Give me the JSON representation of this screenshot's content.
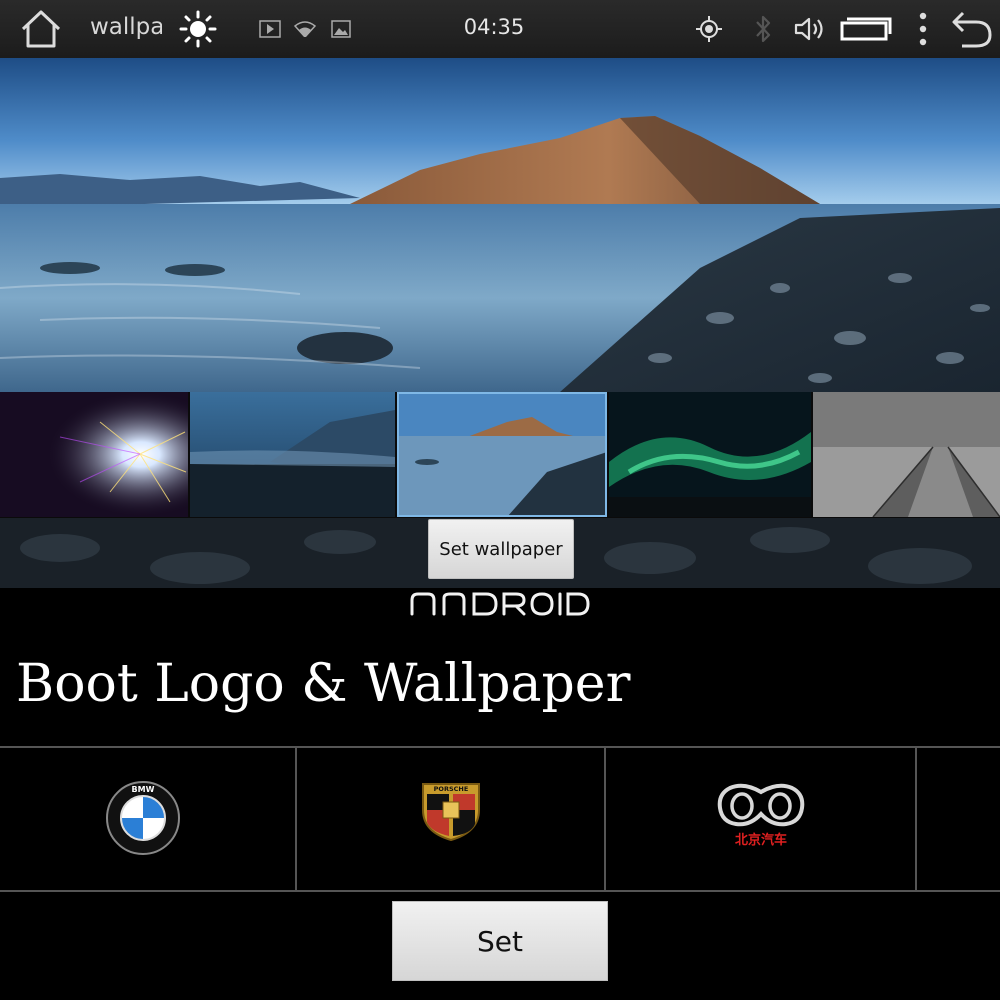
{
  "status_bar": {
    "app_title": "wallpaper",
    "time": "04:35",
    "icons": [
      "home-icon",
      "brightness-icon",
      "play-icon",
      "wifi-icon",
      "image-icon",
      "gps-icon",
      "bluetooth-icon",
      "volume-icon",
      "recent-apps-icon",
      "overflow-menu-icon",
      "back-icon"
    ]
  },
  "wallpaper_picker": {
    "thumbnails": [
      "Fireworks",
      "Coastal cliff",
      "Mountain lake",
      "Aurora",
      "Pier"
    ],
    "selected": 2,
    "set_wallpaper_label": "Set wallpaper"
  },
  "boot_logo": {
    "current_logo": "ANDROID",
    "heading": "Boot Logo & Wallpaper",
    "logos": [
      "BMW",
      "Porsche",
      "北京汽车"
    ],
    "bmw_text": "BMW",
    "porsche_text": "PORSCHE",
    "baic_text": "北京汽车",
    "set_label": "Set"
  },
  "colors": {
    "accent": "#7fb8e6",
    "background": "#000000",
    "button": "#e4e4e4"
  }
}
